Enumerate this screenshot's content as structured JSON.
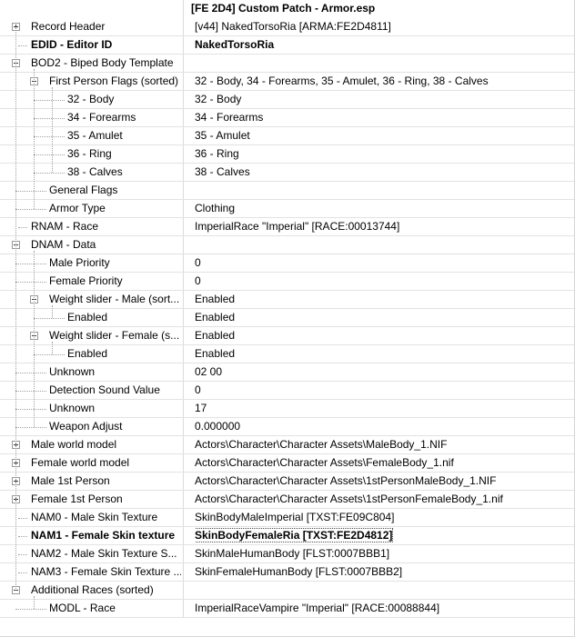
{
  "window": {
    "title": "[FE 2D4] Custom Patch - Armor.esp"
  },
  "rows": [
    {
      "name": "Record Header",
      "value": "[v44] NakedTorsoRia [ARMA:FE2D4811]"
    },
    {
      "name": "EDID - Editor ID",
      "value": "NakedTorsoRia"
    },
    {
      "name": "BOD2 - Biped Body Template",
      "value": ""
    },
    {
      "name": "First Person Flags (sorted)",
      "value": "32 - Body, 34 - Forearms, 35 - Amulet, 36 - Ring, 38 - Calves"
    },
    {
      "name": "32 - Body",
      "value": "32 - Body"
    },
    {
      "name": "34 - Forearms",
      "value": "34 - Forearms"
    },
    {
      "name": "35 - Amulet",
      "value": "35 - Amulet"
    },
    {
      "name": "36 - Ring",
      "value": "36 - Ring"
    },
    {
      "name": "38 - Calves",
      "value": "38 - Calves"
    },
    {
      "name": "General Flags",
      "value": ""
    },
    {
      "name": "Armor Type",
      "value": "Clothing"
    },
    {
      "name": "RNAM - Race",
      "value": "ImperialRace \"Imperial\" [RACE:00013744]"
    },
    {
      "name": "DNAM - Data",
      "value": ""
    },
    {
      "name": "Male Priority",
      "value": "0"
    },
    {
      "name": "Female Priority",
      "value": "0"
    },
    {
      "name": "Weight slider - Male (sort...",
      "value": "Enabled"
    },
    {
      "name": "Enabled",
      "value": "Enabled"
    },
    {
      "name": "Weight slider - Female (s...",
      "value": "Enabled"
    },
    {
      "name": "Enabled",
      "value": "Enabled"
    },
    {
      "name": "Unknown",
      "value": "02 00"
    },
    {
      "name": "Detection Sound Value",
      "value": "0"
    },
    {
      "name": "Unknown",
      "value": "17"
    },
    {
      "name": "Weapon Adjust",
      "value": "0.000000"
    },
    {
      "name": "Male world model",
      "value": "Actors\\Character\\Character Assets\\MaleBody_1.NIF"
    },
    {
      "name": "Female world model",
      "value": "Actors\\Character\\Character Assets\\FemaleBody_1.nif"
    },
    {
      "name": "Male 1st Person",
      "value": "Actors\\Character\\Character Assets\\1stPersonMaleBody_1.NIF"
    },
    {
      "name": "Female 1st Person",
      "value": "Actors\\Character\\Character Assets\\1stPersonFemaleBody_1.nif"
    },
    {
      "name": "NAM0 - Male Skin Texture",
      "value": "SkinBodyMaleImperial [TXST:FE09C804]"
    },
    {
      "name": "NAM1 - Female Skin texture",
      "value": "SkinBodyFemaleRia [TXST:FE2D4812]"
    },
    {
      "name": "NAM2 - Male Skin Texture S...",
      "value": "SkinMaleHumanBody [FLST:0007BBB1]"
    },
    {
      "name": "NAM3 - Female Skin Texture ...",
      "value": "SkinFemaleHumanBody [FLST:0007BBB2]"
    },
    {
      "name": "Additional Races (sorted)",
      "value": ""
    },
    {
      "name": "MODL - Race",
      "value": "ImperialRaceVampire \"Imperial\" [RACE:00088844]"
    }
  ],
  "colors": {
    "background": "#ffffff",
    "grid": "#e2e2e2",
    "tree_line": "#a0a0a0"
  }
}
